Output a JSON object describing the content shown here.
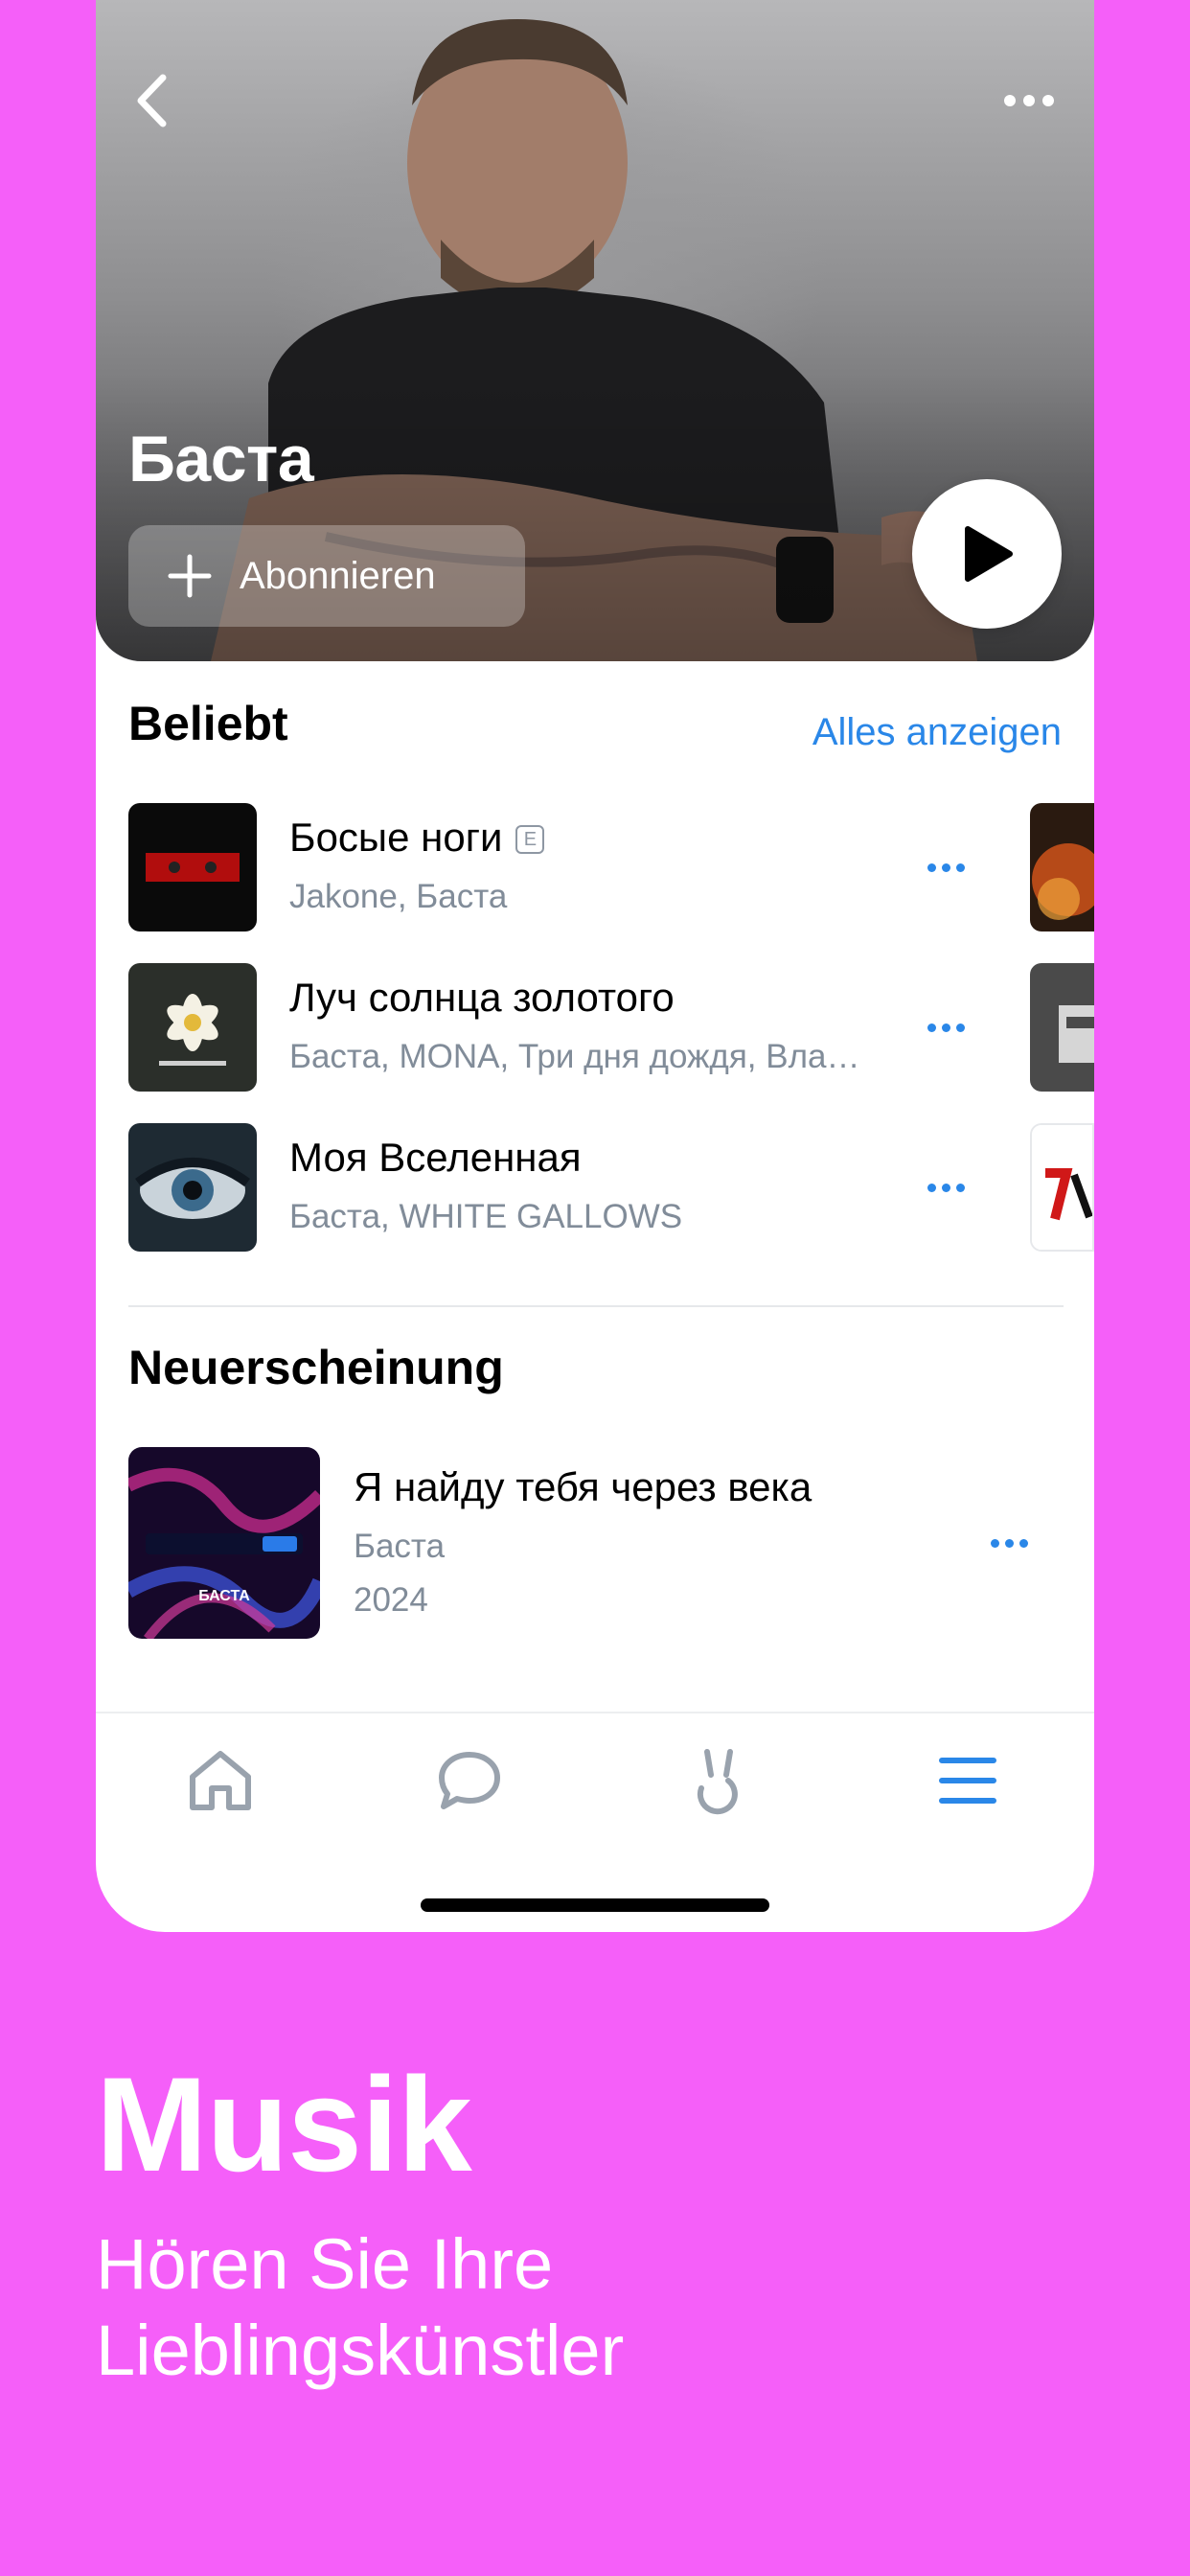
{
  "artist": {
    "name": "Баста",
    "subscribe_label": "Abonnieren"
  },
  "popular": {
    "title": "Beliebt",
    "show_all": "Alles anzeigen",
    "tracks": [
      {
        "title": "Босые ноги",
        "explicit": "E",
        "artists": "Jakone, Баста"
      },
      {
        "title": "Луч солнца золотого",
        "artists": "Баста, MONA, Три дня дождя, Вла…"
      },
      {
        "title": "Моя Вселенная",
        "artists": "Баста, WHITE GALLOWS"
      }
    ]
  },
  "new_release": {
    "title": "Neuerscheinung",
    "album_title": "Я найду тебя через века",
    "artist": "Баста",
    "year": "2024",
    "cover_text": "БАСТА"
  },
  "tabbar": {
    "icons": [
      "home-icon",
      "messages-icon",
      "clips-icon",
      "menu-icon"
    ],
    "active": "menu-icon"
  },
  "colors": {
    "background": "#f55ff9",
    "accent": "#2a87e8",
    "secondary_text": "#818c99"
  },
  "promo": {
    "title": "Musik",
    "subtitle": "Hören Sie Ihre Lieblingskünstler"
  }
}
